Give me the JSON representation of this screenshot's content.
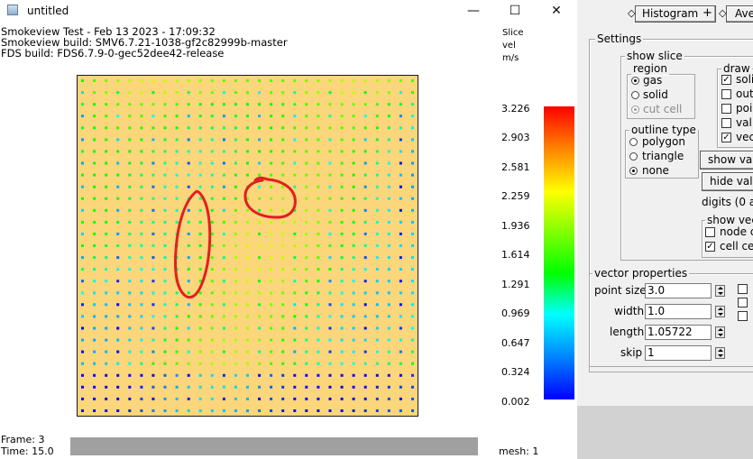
{
  "window": {
    "title": "untitled",
    "minimize_glyph": "—",
    "maximize_glyph": "☐",
    "close_glyph": "✕"
  },
  "header": {
    "line1": "Smokeview  Test - Feb 13 2023 - 17:09:32",
    "line2": "Smokeview build: SMV6.7.21-1038-gf2c82999b-master",
    "line3": "FDS build: FDS6.7.9-0-gec52dee42-release"
  },
  "colorbar": {
    "title_lines": [
      "Slice",
      "vel",
      "m/s"
    ],
    "ticks": [
      "3.226",
      "2.903",
      "2.581",
      "2.259",
      "1.936",
      "1.614",
      "1.291",
      "0.969",
      "0.647",
      "0.324",
      "0.002"
    ],
    "colors": [
      "#ff0000",
      "#ff8000",
      "#ffff00",
      "#80ff00",
      "#00ff00",
      "#00ffff",
      "#0080ff",
      "#0000ff"
    ]
  },
  "plot": {
    "background": "#fcd67a",
    "grid_n": 29,
    "annotation_color": "#e02020"
  },
  "footer": {
    "frame": "Frame: 3",
    "time": "Time: 15.0",
    "mesh": "mesh: 1"
  },
  "panel": {
    "histogram_button": "Histogram",
    "histogram_plus": "+",
    "average_button_partial": "Ave",
    "settings_title": "Settings",
    "show_slice_title": "show slice",
    "region_title": "region",
    "region_options": [
      "gas",
      "solid",
      "cut cell"
    ],
    "region_selected": "gas",
    "draw_title": "draw",
    "draw_items": [
      {
        "label": "soli",
        "checked": true
      },
      {
        "label": "out",
        "checked": false
      },
      {
        "label": "poi",
        "checked": false
      },
      {
        "label": "val",
        "checked": false
      },
      {
        "label": "vec",
        "checked": true
      }
    ],
    "outline_title": "outline type",
    "outline_options": [
      "polygon",
      "triangle",
      "none"
    ],
    "outline_selected": "none",
    "show_values_button": "show val",
    "hide_values_button": "hide valu",
    "digits_label": "digits (0 a",
    "show_vectors_title": "show vec",
    "node_label": "node c",
    "node_checked": false,
    "cell_label": "cell ce",
    "cell_checked": true,
    "vector_properties_title": "vector properties",
    "fields": [
      {
        "label": "point size",
        "value": "3.0"
      },
      {
        "label": "width",
        "value": "1.0"
      },
      {
        "label": "length",
        "value": "1.05722"
      },
      {
        "label": "skip",
        "value": "1"
      }
    ]
  }
}
